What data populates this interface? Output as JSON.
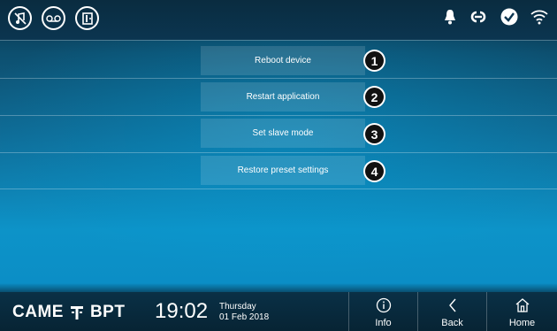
{
  "menu": {
    "items": [
      {
        "label": "Reboot device",
        "number": "1"
      },
      {
        "label": "Restart application",
        "number": "2"
      },
      {
        "label": "Set slave mode",
        "number": "3"
      },
      {
        "label": "Restore preset settings",
        "number": "4"
      }
    ]
  },
  "footer": {
    "brand_left": "CAME",
    "brand_right": "BPT",
    "time": "19:02",
    "day": "Thursday",
    "date": "01 Feb 2018",
    "info_label": "Info",
    "back_label": "Back",
    "home_label": "Home"
  },
  "icons": {
    "top_left": [
      "mute-icon",
      "voicemail-icon",
      "door-icon"
    ],
    "top_right": [
      "bell-icon",
      "link-icon",
      "check-icon",
      "wifi-icon"
    ]
  },
  "colors": {
    "background_top": "#082a3d",
    "background_bottom": "#0b8ec6",
    "button_bg": "#ffffff22"
  }
}
